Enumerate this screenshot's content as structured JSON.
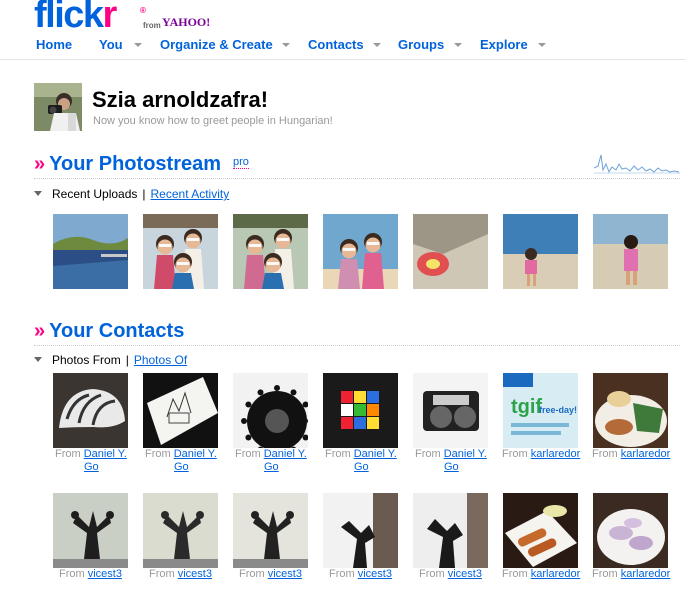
{
  "logo": {
    "brand": "flick",
    "brand_end": "r",
    "from": "from",
    "yahoo": "YAHOO!"
  },
  "nav": {
    "items": [
      {
        "label": "Home",
        "has_menu": false
      },
      {
        "label": "You",
        "has_menu": true
      },
      {
        "label": "Organize & Create",
        "has_menu": true
      },
      {
        "label": "Contacts",
        "has_menu": true
      },
      {
        "label": "Groups",
        "has_menu": true
      },
      {
        "label": "Explore",
        "has_menu": true
      }
    ]
  },
  "greeting": {
    "title": "Szia arnoldzafra!",
    "subtitle": "Now you know how to greet people in Hungarian!"
  },
  "photostream": {
    "title": "Your Photostream",
    "badge": "pro",
    "tab_active": "Recent Uploads",
    "tab_link": "Recent Activity",
    "photos": [
      {
        "scene": "lake-pool",
        "colors": [
          "#3a6ea5",
          "#2a4e85",
          "#6d8a3f"
        ]
      },
      {
        "scene": "kids-boat",
        "colors": [
          "#c9d5dc",
          "#7a6a58",
          "#d04a6a"
        ]
      },
      {
        "scene": "kids-boat-2",
        "colors": [
          "#b8c8b4",
          "#5c6a48",
          "#d06a90"
        ]
      },
      {
        "scene": "kids-beach",
        "colors": [
          "#6fa7cf",
          "#e9d7b8",
          "#d08fb0"
        ]
      },
      {
        "scene": "sand-float",
        "colors": [
          "#cfc7b6",
          "#7b7364",
          "#e05050"
        ]
      },
      {
        "scene": "girl-sea",
        "colors": [
          "#3e7fb8",
          "#d9cdb6",
          "#e26aa0"
        ]
      },
      {
        "scene": "girl-sand",
        "colors": [
          "#8fb5d0",
          "#d6cbb3",
          "#e070b0"
        ]
      }
    ]
  },
  "contacts": {
    "title": "Your Contacts",
    "tab_active": "Photos From",
    "tab_link": "Photos Of",
    "caption_prefix": "From",
    "row1": [
      {
        "scene": "helmet",
        "author": "Daniel Y.",
        "author2": "Go"
      },
      {
        "scene": "sketch",
        "author": "Daniel Y.",
        "author2": "Go"
      },
      {
        "scene": "gear",
        "author": "Daniel Y.",
        "author2": "Go"
      },
      {
        "scene": "rubik",
        "author": "Daniel Y.",
        "author2": "Go"
      },
      {
        "scene": "camera",
        "author": "Daniel Y.",
        "author2": "Go"
      },
      {
        "scene": "tgif-poster",
        "author": "karlaredor",
        "author2": "",
        "poster_text": "tgif",
        "poster_sub": "free-day!"
      },
      {
        "scene": "food-plate",
        "author": "karlaredor",
        "author2": ""
      }
    ],
    "row2": [
      {
        "scene": "sculpture",
        "author": "vicest3"
      },
      {
        "scene": "sculpture-2",
        "author": "vicest3"
      },
      {
        "scene": "sculpture-3",
        "author": "vicest3"
      },
      {
        "scene": "sculpture-bw",
        "author": "vicest3"
      },
      {
        "scene": "sculpture-bw-2",
        "author": "vicest3"
      },
      {
        "scene": "fried-food",
        "author": "karlaredor"
      },
      {
        "scene": "dessert",
        "author": "karlaredor"
      }
    ]
  }
}
